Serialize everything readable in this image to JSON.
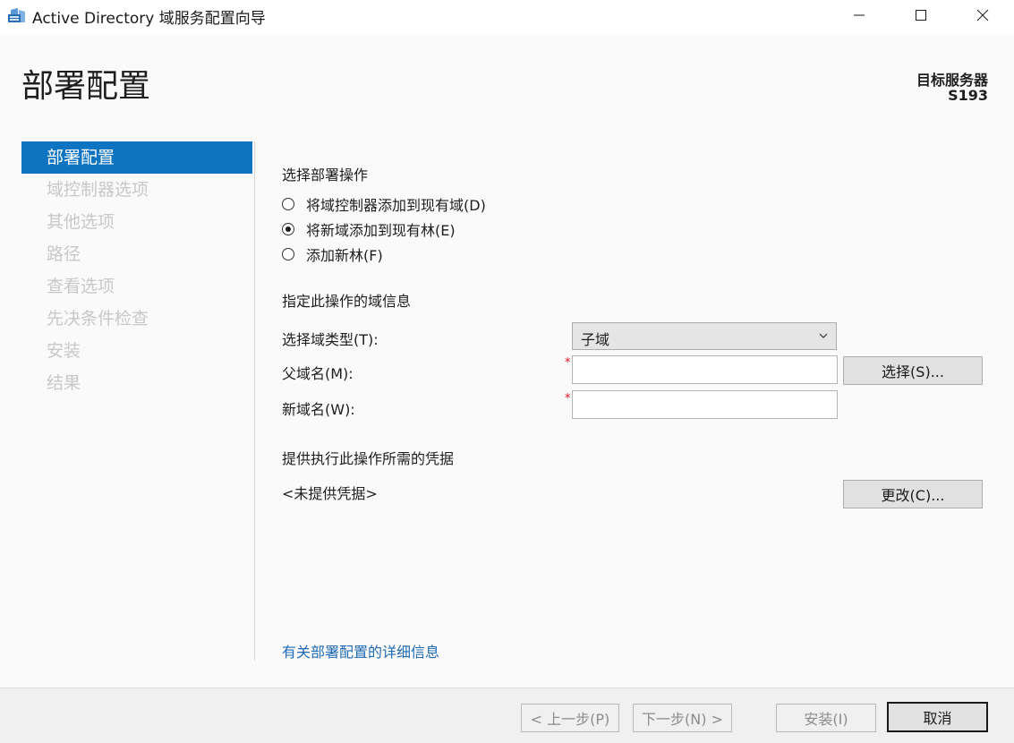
{
  "window": {
    "title": "Active Directory 域服务配置向导",
    "icon": "server-manager-icon"
  },
  "header": {
    "page_title": "部署配置",
    "target_label": "目标服务器",
    "target_name": "S193"
  },
  "sidebar": {
    "items": [
      {
        "label": "部署配置",
        "active": true
      },
      {
        "label": "域控制器选项",
        "active": false
      },
      {
        "label": "其他选项",
        "active": false
      },
      {
        "label": "路径",
        "active": false
      },
      {
        "label": "查看选项",
        "active": false
      },
      {
        "label": "先决条件检查",
        "active": false
      },
      {
        "label": "安装",
        "active": false
      },
      {
        "label": "结果",
        "active": false
      }
    ]
  },
  "main": {
    "deploy_heading": "选择部署操作",
    "options": [
      {
        "label": "将域控制器添加到现有域(D)",
        "checked": false
      },
      {
        "label": "将新域添加到现有林(E)",
        "checked": true
      },
      {
        "label": "添加新林(F)",
        "checked": false
      }
    ],
    "domain_heading": "指定此操作的域信息",
    "domain_type_label": "选择域类型(T):",
    "domain_type_value": "子域",
    "parent_label": "父域名(M):",
    "parent_value": "",
    "new_label": "新域名(W):",
    "new_value": "",
    "required_mark": "*",
    "select_button": "选择(S)...",
    "cred_heading": "提供执行此操作所需的凭据",
    "cred_value": "<未提供凭据>",
    "change_button": "更改(C)...",
    "more_link": "有关部署配置的详细信息"
  },
  "footer": {
    "prev": "< 上一步(P)",
    "next": "下一步(N) >",
    "install": "安装(I)",
    "cancel": "取消"
  },
  "colors": {
    "accent": "#0e73c1",
    "link": "#1f6ab3",
    "required": "#e81123"
  }
}
